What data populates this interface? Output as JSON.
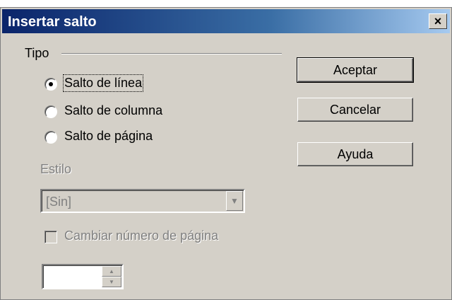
{
  "window": {
    "title": "Insertar salto",
    "close_symbol": "×"
  },
  "tipo": {
    "group_label": "Tipo",
    "options": [
      {
        "label": "Salto de línea",
        "selected": true
      },
      {
        "label": "Salto de columna",
        "selected": false
      },
      {
        "label": "Salto de página",
        "selected": false
      }
    ]
  },
  "estilo": {
    "label": "Estilo",
    "value": "[Sin]",
    "enabled": false
  },
  "cambiar": {
    "label": "Cambiar número de página",
    "checked": false,
    "enabled": false
  },
  "page_number": {
    "value": ""
  },
  "buttons": {
    "ok": "Aceptar",
    "cancel": "Cancelar",
    "help": "Ayuda"
  },
  "colors": {
    "title_start": "#0a246a",
    "title_end": "#a6caf0",
    "face": "#d4d0c8",
    "disabled_text": "#808080"
  }
}
